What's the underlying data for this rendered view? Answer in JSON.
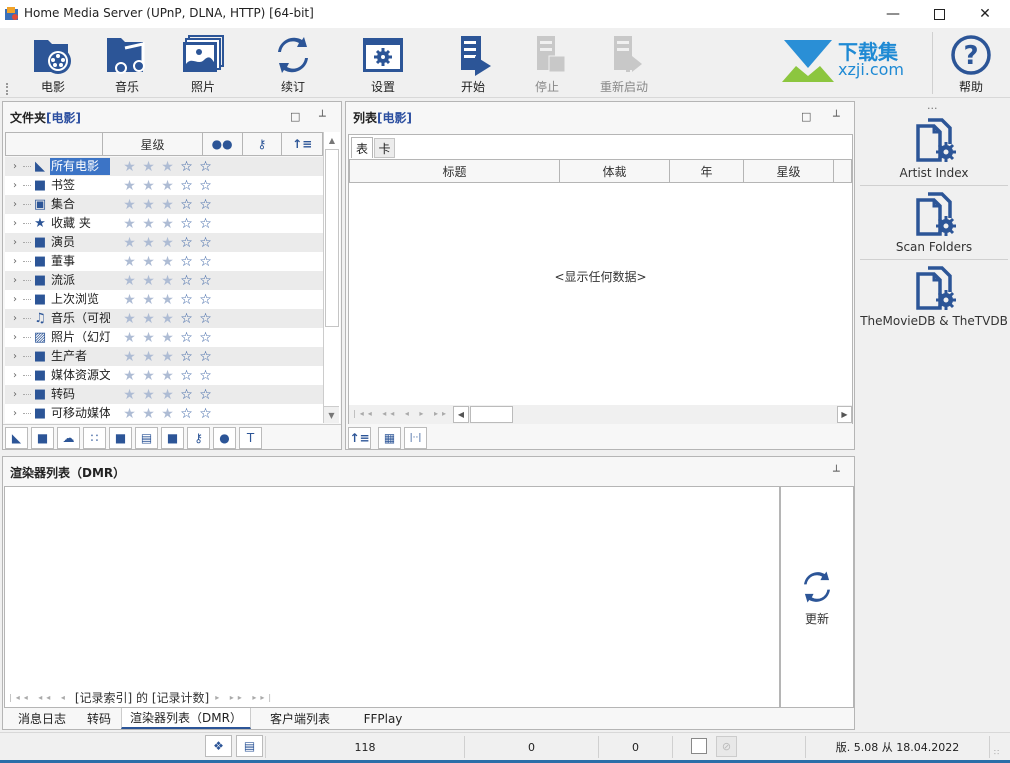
{
  "window": {
    "title": "Home Media Server (UPnP, DLNA, HTTP) [64-bit]",
    "minimize_icon": "minimize-icon",
    "maximize_icon": "maximize-icon",
    "close_icon": "close-icon"
  },
  "toolbar": {
    "buttons": [
      {
        "label": "电影",
        "icon": "movie-folder-icon",
        "enabled": true
      },
      {
        "label": "音乐",
        "icon": "music-folder-icon",
        "enabled": true
      },
      {
        "label": "照片",
        "icon": "photo-icon",
        "enabled": true
      },
      {
        "label": "续订",
        "icon": "refresh-icon",
        "enabled": true
      },
      {
        "label": "设置",
        "icon": "settings-icon",
        "enabled": true
      },
      {
        "label": "开始",
        "icon": "server-start-icon",
        "enabled": true
      },
      {
        "label": "停止",
        "icon": "server-stop-icon",
        "enabled": false
      },
      {
        "label": "重新启动",
        "icon": "server-restart-icon",
        "enabled": false
      }
    ],
    "watermark": {
      "title": "下载集",
      "subtitle": "xzji.com"
    },
    "help_label": "帮助"
  },
  "folders_panel": {
    "title_prefix": "文件夹 ",
    "title_bracket": "[电影]",
    "columns": [
      "",
      "星级",
      "people-icon",
      "key-icon",
      "sort-icon"
    ],
    "rows": [
      {
        "label": "所有电影",
        "icon": "open-folder-icon",
        "rating": 3,
        "selected": true
      },
      {
        "label": "书签",
        "icon": "bookmark-folder-icon",
        "rating": 3
      },
      {
        "label": "集合",
        "icon": "collection-icon",
        "rating": 3
      },
      {
        "label": "收藏 夹",
        "icon": "star-icon",
        "rating": 3
      },
      {
        "label": "演员",
        "icon": "actor-folder-icon",
        "rating": 3
      },
      {
        "label": "董事",
        "icon": "director-folder-icon",
        "rating": 3
      },
      {
        "label": "流派",
        "icon": "genre-folder-icon",
        "rating": 3
      },
      {
        "label": "上次浏览",
        "icon": "recent-folder-icon",
        "rating": 3
      },
      {
        "label": "音乐（可视",
        "icon": "music-folder-icon",
        "rating": 3
      },
      {
        "label": "照片（幻灯",
        "icon": "photo-icon",
        "rating": 3
      },
      {
        "label": "生产者",
        "icon": "producer-folder-icon",
        "rating": 3
      },
      {
        "label": "媒体资源文",
        "icon": "search-folder-icon",
        "rating": 3
      },
      {
        "label": "转码",
        "icon": "transcode-folder-icon",
        "rating": 3
      },
      {
        "label": "可移动媒体",
        "icon": "removable-media-icon",
        "rating": 3
      }
    ],
    "max_rating": 5,
    "bottom_tools": [
      "open-folder-edit-icon",
      "add-folder-icon",
      "weather-icon",
      "grid-dots-icon",
      "folder-refresh-icon",
      "save-icon",
      "folder-refresh2-icon",
      "key-icon",
      "people-icon",
      "text-t-icon"
    ]
  },
  "list_panel": {
    "title_prefix": "列表 ",
    "title_bracket": "[电影]",
    "tabs": [
      "表",
      "卡"
    ],
    "columns": [
      "标题",
      "体裁",
      "年",
      "星级"
    ],
    "empty_text": "<显示任何数据>",
    "bottom_tools": [
      "sort-icon",
      "table-settings-icon",
      "column-fit-icon"
    ]
  },
  "side_panel": {
    "more": "...",
    "items": [
      {
        "label": "Artist Index",
        "icon": "document-gear-icon"
      },
      {
        "label": "Scan Folders",
        "icon": "document-gear-icon"
      },
      {
        "label": "TheMovieDB & TheTVDB",
        "icon": "document-gear-icon"
      }
    ]
  },
  "renderer_panel": {
    "title": "渲染器列表（DMR）",
    "nav_text": "[记录索引] 的 [记录计数]",
    "refresh_label": "更新"
  },
  "bottom_tabs": [
    {
      "label": "消息日志",
      "active": false
    },
    {
      "label": "转码",
      "active": false
    },
    {
      "label": "渲染器列表（DMR）",
      "active": true
    },
    {
      "label": "客户端列表",
      "active": false
    },
    {
      "label": "FFPlay",
      "active": false
    }
  ],
  "status_bar": {
    "count1": "118",
    "count2": "0",
    "count3": "0",
    "version": "版. 5.08 从 18.04.2022"
  },
  "colors": {
    "accent": "#2c5597",
    "selection": "#3c74c6",
    "star_filled": "#aebcd4",
    "star_empty": "#2f5aa0"
  }
}
